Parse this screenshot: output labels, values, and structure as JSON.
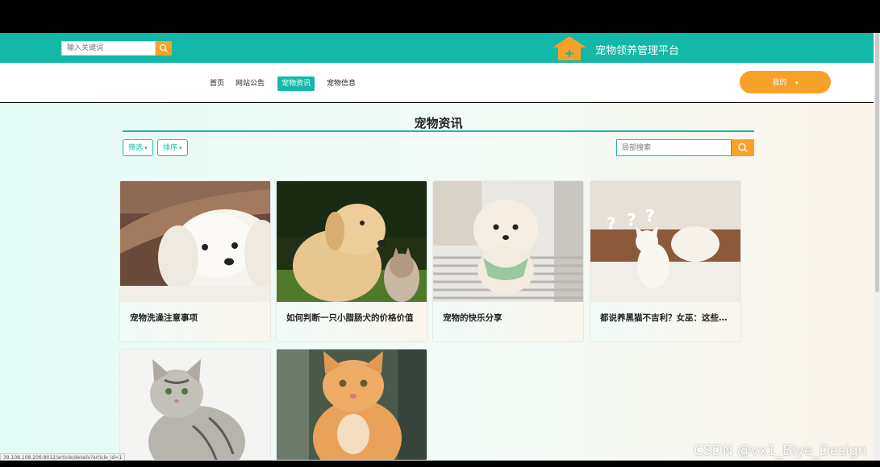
{
  "header": {
    "search_placeholder": "输入关键词",
    "site_title": "宠物领养管理平台"
  },
  "nav": {
    "items": [
      {
        "label": "首页"
      },
      {
        "label": "网站公告"
      },
      {
        "label": "宠物资讯"
      },
      {
        "label": "宠物信息"
      }
    ],
    "active": "宠物资讯",
    "me_label": "我的",
    "me_caret": "▾"
  },
  "main": {
    "title": "宠物资讯",
    "filter_label": "筛选",
    "sort_label": "排序",
    "caret": "▾",
    "local_search_placeholder": "局部搜索"
  },
  "cards": [
    {
      "title": "宠物洗澡注意事项",
      "image": "white-puppy-photo"
    },
    {
      "title": "如何判断一只小腊肠犬的价格价值",
      "image": "puppy-and-kitten-photo"
    },
    {
      "title": "宠物的快乐分享",
      "image": "pomeranian-photo"
    },
    {
      "title": "都说养黑猫不吉利？女巫：这些…",
      "image": "white-cat-question-marks-photo"
    },
    {
      "title": "",
      "image": "tabby-cat-photo"
    },
    {
      "title": "",
      "image": "orange-kitten-photo"
    }
  ],
  "status_bar": {
    "url": "39.108.108.206:8012/article/details?article_id=1"
  },
  "watermark": "CSDN @vx1_Biye_Design",
  "colors": {
    "teal": "#13b8a8",
    "orange": "#f7a128"
  }
}
